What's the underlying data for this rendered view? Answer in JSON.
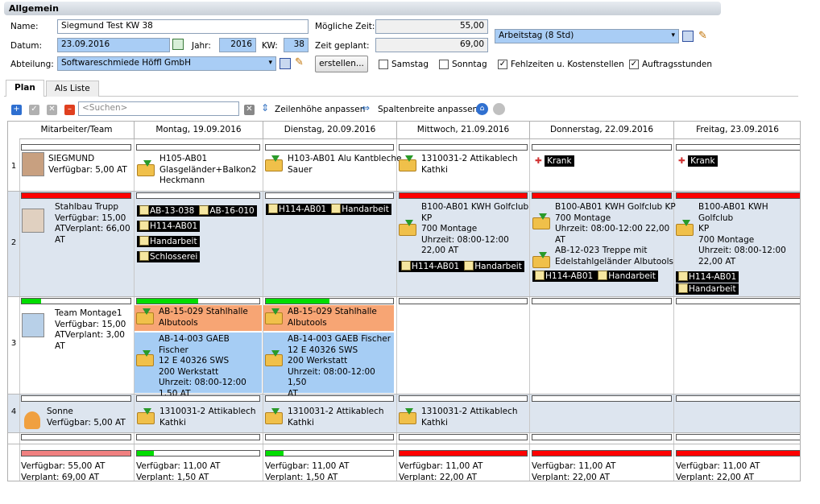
{
  "section_title": "Allgemein",
  "form": {
    "name_label": "Name:",
    "name_value": "Siegmund Test KW 38",
    "datum_label": "Datum:",
    "datum_value": "23.09.2016",
    "jahr_label": "Jahr:",
    "jahr_value": "2016",
    "kw_label": "KW:",
    "kw_value": "38",
    "abteilung_label": "Abteilung:",
    "abteilung_value": "Softwareschmiede Höffl GmbH",
    "moegliche_label": "Mögliche Zeit:",
    "moegliche_value": "55,00",
    "geplant_label": "Zeit geplant:",
    "geplant_value": "69,00",
    "arbeitstag_value": "Arbeitstag (8 Std)",
    "erstellen_label": "erstellen...",
    "samstag_label": "Samstag",
    "samstag_checked": false,
    "sonntag_label": "Sonntag",
    "sonntag_checked": false,
    "fehlzeiten_label": "Fehlzeiten u. Kostenstellen",
    "fehlzeiten_checked": true,
    "auftrag_label": "Auftragsstunden",
    "auftrag_checked": true
  },
  "tabs": [
    "Plan",
    "Als Liste"
  ],
  "toolbar": {
    "search_placeholder": "<Suchen>",
    "zeilenhoehe": "Zeilenhöhe anpassen",
    "spaltenbreite": "Spaltenbreite anpassen"
  },
  "columns": [
    "Mitarbeiter/Team",
    "Montag, 19.09.2016",
    "Dienstag, 20.09.2016",
    "Mittwoch, 21.09.2016",
    "Donnerstag, 22.09.2016",
    "Freitag, 23.09.2016"
  ],
  "rows": [
    {
      "num": "1",
      "name": "SIEGMUND",
      "l1": "Verfügbar: 5,00 AT",
      "mon": [
        "H105-AB01",
        "Glasgeländer+Balkon2",
        "Heckmann"
      ],
      "die": [
        "H103-AB01 Alu Kantbleche",
        "Sauer"
      ],
      "mit": [
        "1310031-2 Attikablech",
        "Kathki"
      ],
      "don": "Krank",
      "fre": "Krank"
    },
    {
      "num": "2",
      "name": "Stahlbau Trupp",
      "l1": "Verfügbar: 15,00",
      "l2": "ATVerplant: 66,00",
      "l3": "AT",
      "mon_tags": [
        "AB-13-038",
        "AB-16-010",
        "H114-AB01",
        "Handarbeit",
        "Schlosserei"
      ],
      "die_tags": [
        "H114-AB01",
        "Handarbeit"
      ],
      "mit": [
        "B100-AB01 KWH Golfclub",
        "KP",
        "700 Montage",
        "Uhrzeit: 08:00-12:00",
        "22,00 AT"
      ],
      "mit_tags": [
        "H114-AB01",
        "Handarbeit"
      ],
      "don": [
        "B100-AB01 KWH Golfclub KP",
        "700 Montage",
        "Uhrzeit: 08:00-12:00 22,00",
        "AT"
      ],
      "don2": [
        "AB-12-023 Treppe mit",
        "Edelstahlgeländer Albutools"
      ],
      "don_tags": [
        "H114-AB01",
        "Handarbeit"
      ],
      "fre": [
        "B100-AB01 KWH Golfclub",
        "KP",
        "700 Montage",
        "Uhrzeit: 08:00-12:00",
        "22,00 AT"
      ],
      "fre_tags": [
        "H114-AB01",
        "Handarbeit"
      ]
    },
    {
      "num": "3",
      "name": "Team Montage1",
      "l1": "Verfügbar: 15,00",
      "l2": "ATVerplant: 3,00",
      "l3": "AT",
      "mon_o": [
        "AB-15-029 Stahlhalle",
        "Albutools"
      ],
      "mon_b": [
        "AB-14-003 GAEB Fischer",
        "12 E 40326 SWS",
        "200 Werkstatt",
        "Uhrzeit: 08:00-12:00",
        "1,50 AT"
      ],
      "die_o": [
        "AB-15-029 Stahlhalle",
        "Albutools"
      ],
      "die_b": [
        "AB-14-003 GAEB Fischer",
        "12 E 40326 SWS",
        "200 Werkstatt",
        "Uhrzeit: 08:00-12:00 1,50",
        "AT"
      ]
    },
    {
      "num": "4",
      "name": "Sonne",
      "l1": "Verfügbar: 5,00 AT",
      "mon": [
        "1310031-2 Attikablech",
        "Kathki"
      ],
      "die": [
        "1310031-2 Attikablech",
        "Kathki"
      ],
      "mit": [
        "1310031-2 Attikablech",
        "Kathki"
      ]
    }
  ],
  "footer": [
    {
      "v": "Verfügbar: 55,00 AT",
      "p": "Verplant: 69,00 AT"
    },
    {
      "v": "Verfügbar: 11,00 AT",
      "p": "Verplant: 1,50 AT"
    },
    {
      "v": "Verfügbar: 11,00 AT",
      "p": "Verplant: 1,50 AT"
    },
    {
      "v": "Verfügbar: 11,00 AT",
      "p": "Verplant: 22,00 AT"
    },
    {
      "v": "Verfügbar: 11,00 AT",
      "p": "Verplant: 22,00 AT"
    },
    {
      "v": "Verfügbar: 11,00 AT",
      "p": "Verplant: 22,00 AT"
    }
  ],
  "colors": {
    "over": "#ff0000",
    "ok": "#00dd00",
    "footer_summary": "#f08080"
  }
}
